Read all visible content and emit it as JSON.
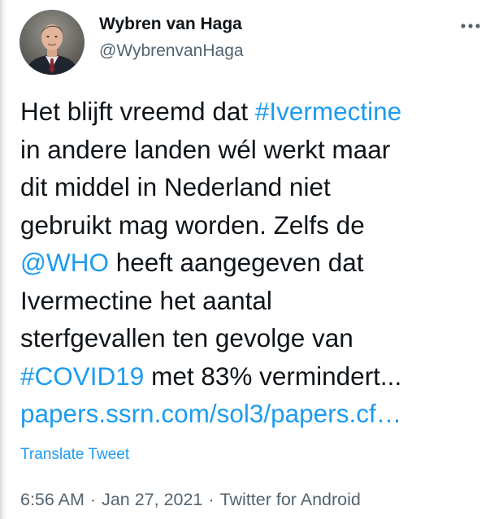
{
  "author": {
    "display_name": "Wybren van Haga",
    "handle": "@WybrenvanHaga",
    "avatar_icon": "profile-photo"
  },
  "more_icon": "more-horizontal-icon",
  "tweet": {
    "lines": [
      [
        {
          "text": "Het blijft vreemd dat "
        },
        {
          "text": "#Ivermectine",
          "link": true
        }
      ],
      [
        {
          "text": "in andere landen wél werkt maar"
        }
      ],
      [
        {
          "text": "dit middel in Nederland niet"
        }
      ],
      [
        {
          "text": "gebruikt mag worden. Zelfs de"
        }
      ],
      [
        {
          "text": "@WHO",
          "link": true
        },
        {
          "text": " heeft aangegeven dat"
        }
      ],
      [
        {
          "text": "Ivermectine het aantal"
        }
      ],
      [
        {
          "text": "sterfgevallen ten gevolge van"
        }
      ],
      [
        {
          "text": "#COVID19",
          "link": true
        },
        {
          "text": " met 83% vermindert..."
        }
      ],
      [
        {
          "text": "papers.ssrn.com/sol3/papers.cf…",
          "link": true
        }
      ]
    ]
  },
  "translate_label": "Translate Tweet",
  "meta": {
    "time": "6:56 AM",
    "date": "Jan 27, 2021",
    "source": "Twitter for Android",
    "separator": "·"
  },
  "colors": {
    "link": "#1d9bf0",
    "text": "#0f1419",
    "secondary": "#536471"
  }
}
